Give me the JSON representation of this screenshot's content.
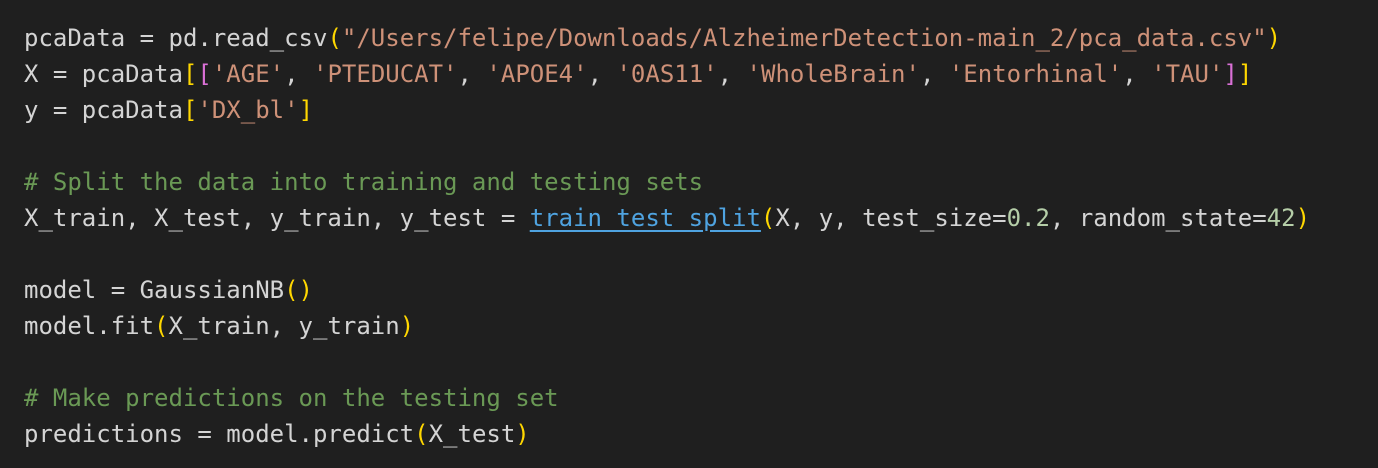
{
  "editor": {
    "lines": [
      {
        "tokens": [
          {
            "text": "pcaData = pd.read_csv",
            "type": "plain"
          },
          {
            "text": "(",
            "type": "paren"
          },
          {
            "text": "\"/Users/felipe/Downloads/AlzheimerDetection-main_2/pca_data.csv\"",
            "type": "string"
          },
          {
            "text": ")",
            "type": "paren"
          }
        ]
      },
      {
        "tokens": [
          {
            "text": "X = pcaData",
            "type": "plain"
          },
          {
            "text": "[",
            "type": "bracket1"
          },
          {
            "text": "[",
            "type": "bracket2"
          },
          {
            "text": "'AGE'",
            "type": "string"
          },
          {
            "text": ", ",
            "type": "plain"
          },
          {
            "text": "'PTEDUCAT'",
            "type": "string"
          },
          {
            "text": ", ",
            "type": "plain"
          },
          {
            "text": "'APOE4'",
            "type": "string"
          },
          {
            "text": ", ",
            "type": "plain"
          },
          {
            "text": "'0AS11'",
            "type": "string"
          },
          {
            "text": ", ",
            "type": "plain"
          },
          {
            "text": "'WholeBrain'",
            "type": "string"
          },
          {
            "text": ", ",
            "type": "plain"
          },
          {
            "text": "'Entorhinal'",
            "type": "string"
          },
          {
            "text": ", ",
            "type": "plain"
          },
          {
            "text": "'TAU'",
            "type": "string"
          },
          {
            "text": "]",
            "type": "bracket2"
          },
          {
            "text": "]",
            "type": "bracket1"
          }
        ]
      },
      {
        "tokens": [
          {
            "text": "y = pcaData",
            "type": "plain"
          },
          {
            "text": "[",
            "type": "bracket1"
          },
          {
            "text": "'DX_bl'",
            "type": "string"
          },
          {
            "text": "]",
            "type": "bracket1"
          }
        ]
      },
      {
        "tokens": []
      },
      {
        "tokens": [
          {
            "text": "# Split the data into training and testing sets",
            "type": "comment"
          }
        ]
      },
      {
        "tokens": [
          {
            "text": "X_train, X_test, y_train, y_test = ",
            "type": "plain"
          },
          {
            "text": "train_test_split",
            "type": "link"
          },
          {
            "text": "(",
            "type": "paren"
          },
          {
            "text": "X, y, test_size=",
            "type": "plain"
          },
          {
            "text": "0.2",
            "type": "number"
          },
          {
            "text": ", random_state=",
            "type": "plain"
          },
          {
            "text": "42",
            "type": "number"
          },
          {
            "text": ")",
            "type": "paren"
          }
        ]
      },
      {
        "tokens": []
      },
      {
        "tokens": [
          {
            "text": "model = GaussianNB",
            "type": "plain"
          },
          {
            "text": "()",
            "type": "paren"
          }
        ]
      },
      {
        "tokens": [
          {
            "text": "model.fit",
            "type": "plain"
          },
          {
            "text": "(",
            "type": "paren"
          },
          {
            "text": "X_train, y_train",
            "type": "plain"
          },
          {
            "text": ")",
            "type": "paren"
          }
        ]
      },
      {
        "tokens": []
      },
      {
        "tokens": [
          {
            "text": "# Make predictions on the testing set",
            "type": "comment"
          }
        ]
      },
      {
        "tokens": [
          {
            "text": "predictions = model.predict",
            "type": "plain"
          },
          {
            "text": "(",
            "type": "paren"
          },
          {
            "text": "X_test",
            "type": "plain"
          },
          {
            "text": ")",
            "type": "paren"
          }
        ]
      }
    ]
  },
  "colors": {
    "background": "#1f1f1f",
    "plain": "#d4d4d4",
    "string": "#ce9178",
    "number": "#b5cea8",
    "comment": "#6a9955",
    "bracket_gold": "#ffd700",
    "bracket_purple": "#da70d6",
    "link": "#4fa3e0"
  }
}
